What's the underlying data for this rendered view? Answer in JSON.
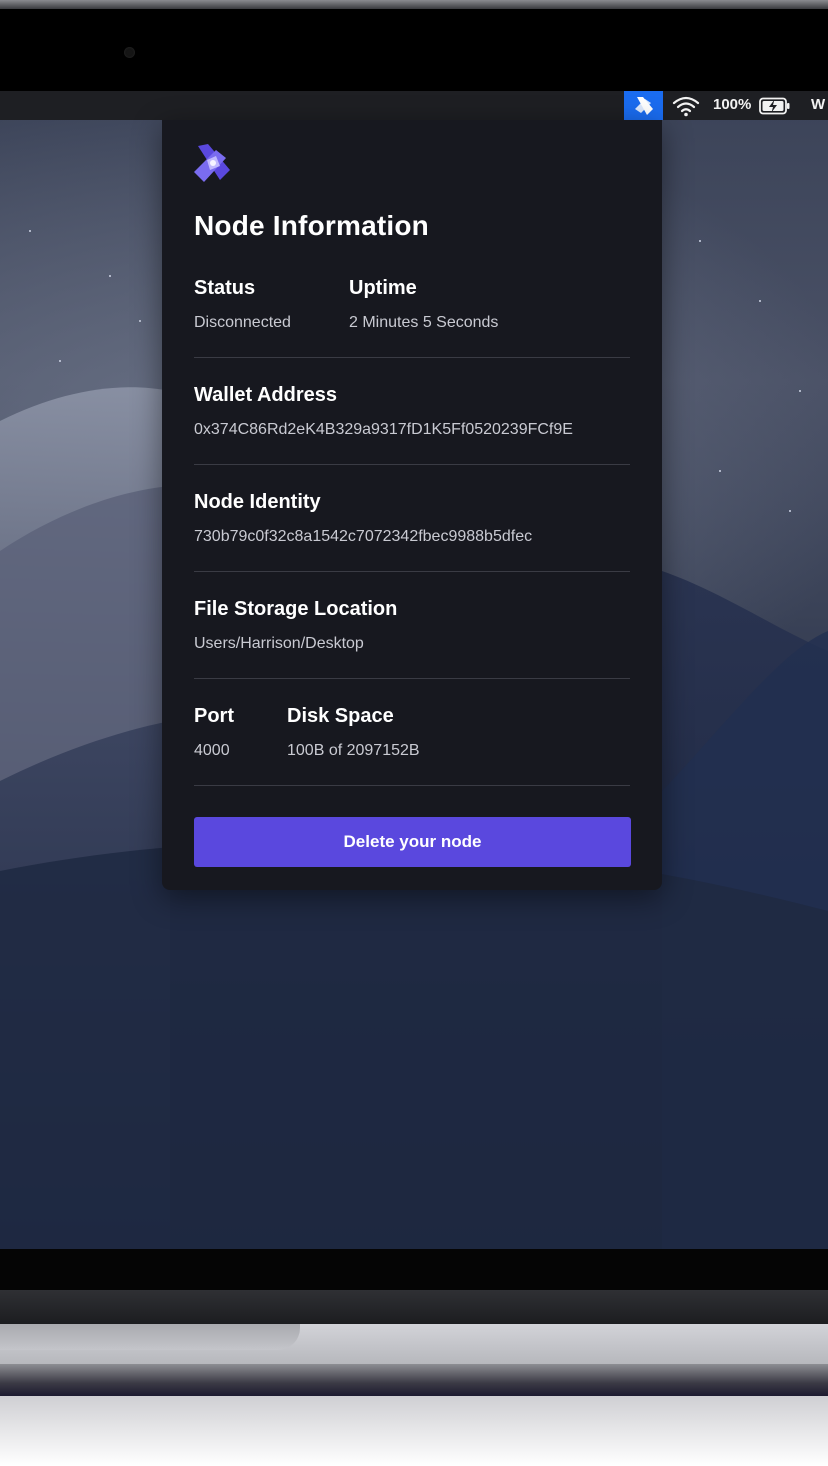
{
  "menubar": {
    "app_icon": "node-app-icon",
    "wifi_icon": "wifi-icon",
    "battery_percent": "100%",
    "battery_icon": "battery-charging-icon",
    "clock_partial": "W"
  },
  "panel": {
    "logo_icon": "node-logo-icon",
    "title": "Node Information",
    "status": {
      "label": "Status",
      "value": "Disconnected"
    },
    "uptime": {
      "label": "Uptime",
      "value": "2 Minutes 5 Seconds"
    },
    "wallet": {
      "label": "Wallet Address",
      "value": "0x374C86Rd2eK4B329a9317fD1K5Ff0520239FCf9E"
    },
    "identity": {
      "label": "Node Identity",
      "value": "730b79c0f32c8a1542c7072342fbec9988b5dfec"
    },
    "storage": {
      "label": "File Storage Location",
      "value": "Users/Harrison/Desktop"
    },
    "port": {
      "label": "Port",
      "value": "4000"
    },
    "disk": {
      "label": "Disk Space",
      "value": "100B of 2097152B"
    },
    "delete_button": "Delete your node"
  },
  "colors": {
    "accent": "#5a48de",
    "panel_bg": "#17181f",
    "menubar_highlight": "#1a6cf0"
  }
}
